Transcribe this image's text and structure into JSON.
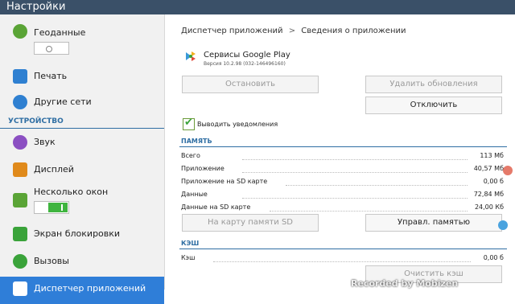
{
  "window": {
    "title": "Настройки"
  },
  "sidebar": {
    "section_label": "УСТРОЙСТВО",
    "items": [
      {
        "label": "Геоданные",
        "icon": "location-icon",
        "color": "#5aa436"
      },
      {
        "label": "Печать",
        "icon": "printer-icon",
        "color": "#2f80d1"
      },
      {
        "label": "Другие сети",
        "icon": "network-icon",
        "color": "#2f80d1"
      },
      {
        "label": "Звук",
        "icon": "sound-icon",
        "color": "#8b4fc2"
      },
      {
        "label": "Дисплей",
        "icon": "display-icon",
        "color": "#e08a1b"
      },
      {
        "label": "Несколько окон",
        "icon": "multiwindow-icon",
        "color": "#5aa436"
      },
      {
        "label": "Экран блокировки",
        "icon": "lockscreen-icon",
        "color": "#3aa33a"
      },
      {
        "label": "Вызовы",
        "icon": "call-icon",
        "color": "#3aa33a"
      },
      {
        "label": "Диспетчер приложений",
        "icon": "apps-icon",
        "color": "#ffffff"
      }
    ]
  },
  "breadcrumb": {
    "parent": "Диспетчер приложений",
    "separator": ">",
    "current": "Сведения о приложении"
  },
  "app": {
    "name": "Сервисы Google Play",
    "version": "Версия 10.2.98 (032-146496160)"
  },
  "buttons": {
    "stop": "Остановить",
    "remove_updates": "Удалить обновления",
    "disable": "Отключить",
    "move_sd": "На карту памяти SD",
    "manage_memory": "Управл. памятью",
    "clear_cache": "Очистить кэш"
  },
  "notifications": {
    "label": "Выводить уведомления",
    "checked": true
  },
  "memory": {
    "title": "ПАМЯТЬ",
    "rows": [
      {
        "label": "Всего",
        "value": "113 Мб"
      },
      {
        "label": "Приложение",
        "value": "40,57 Мб"
      },
      {
        "label": "Приложение на SD карте",
        "value": "0,00 б"
      },
      {
        "label": "Данные",
        "value": "72,84 Мб"
      },
      {
        "label": "Данные на SD карте",
        "value": "24,00 Кб"
      }
    ]
  },
  "cache": {
    "title": "КЭШ",
    "rows": [
      {
        "label": "Кэш",
        "value": "0,00 б"
      }
    ]
  },
  "overlay": {
    "watermark": "Recorded by Mobizen"
  },
  "colors": {
    "accent": "#2f6ea3",
    "selected": "#2f7ed8",
    "statusbar": "#3a5068",
    "toggle_on": "#3fb43f"
  }
}
